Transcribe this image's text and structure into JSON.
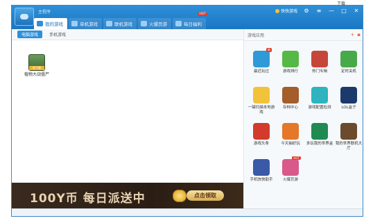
{
  "window": {
    "app_name": "主程序"
  },
  "tabs": [
    {
      "label": "我的游戏",
      "active": true
    },
    {
      "label": "单机游戏",
      "active": false
    },
    {
      "label": "联机游戏",
      "active": false
    },
    {
      "label": "火爆页游",
      "active": false
    },
    {
      "label": "每日福利",
      "active": false,
      "badge": "HOT"
    }
  ],
  "window_controls": {
    "link_label": "快快游戏",
    "settings": "⚙",
    "menu": "≡",
    "minimize": "—",
    "maximize": "□",
    "close": "✕"
  },
  "outside_text": "下载",
  "subtabs": [
    {
      "label": "电脑游戏",
      "active": true
    },
    {
      "label": "手机游戏",
      "active": false
    }
  ],
  "games": [
    {
      "label": "植物大战僵尸",
      "badge": "免下载"
    }
  ],
  "banner": {
    "text": "100Y币 每日派送中",
    "button": "点击领取"
  },
  "right_panel": {
    "title": "游戏应用",
    "apps": [
      {
        "label": "最近玩过",
        "icon": "recent-icon",
        "color": "#2f9ad8",
        "badge": "新"
      },
      {
        "label": "游戏排行",
        "icon": "rank-icon",
        "color": "#56b947"
      },
      {
        "label": "热门专辑",
        "icon": "album-icon",
        "color": "#c7463b"
      },
      {
        "label": "定时关机",
        "icon": "clock-icon",
        "color": "#48a94a"
      },
      {
        "label": "一键扫描本地游戏",
        "icon": "folder-scan-icon",
        "color": "#f2c23a"
      },
      {
        "label": "存档中心",
        "icon": "chest-icon",
        "color": "#a45e2a"
      },
      {
        "label": "游戏配置检测",
        "icon": "first-aid-icon",
        "color": "#2fb3c0"
      },
      {
        "label": "LOL盒子",
        "icon": "lol-icon",
        "color": "#1b3a6b"
      },
      {
        "label": "游戏头条",
        "icon": "news-icon",
        "color": "#d23a2e"
      },
      {
        "label": "今天抽好玩",
        "icon": "tv-icon",
        "color": "#e4772a"
      },
      {
        "label": "多玩我的世界盒",
        "icon": "pickaxe-icon",
        "color": "#1f8a52"
      },
      {
        "label": "我的世界联机大厅",
        "icon": "grass-block-icon",
        "color": "#6b4a2e"
      },
      {
        "label": "手机快快助手",
        "icon": "king-icon",
        "color": "#3a5aa8"
      },
      {
        "label": "火爆页游",
        "icon": "page-game-icon",
        "color": "#d95a8a",
        "badge": "HOT"
      }
    ]
  }
}
